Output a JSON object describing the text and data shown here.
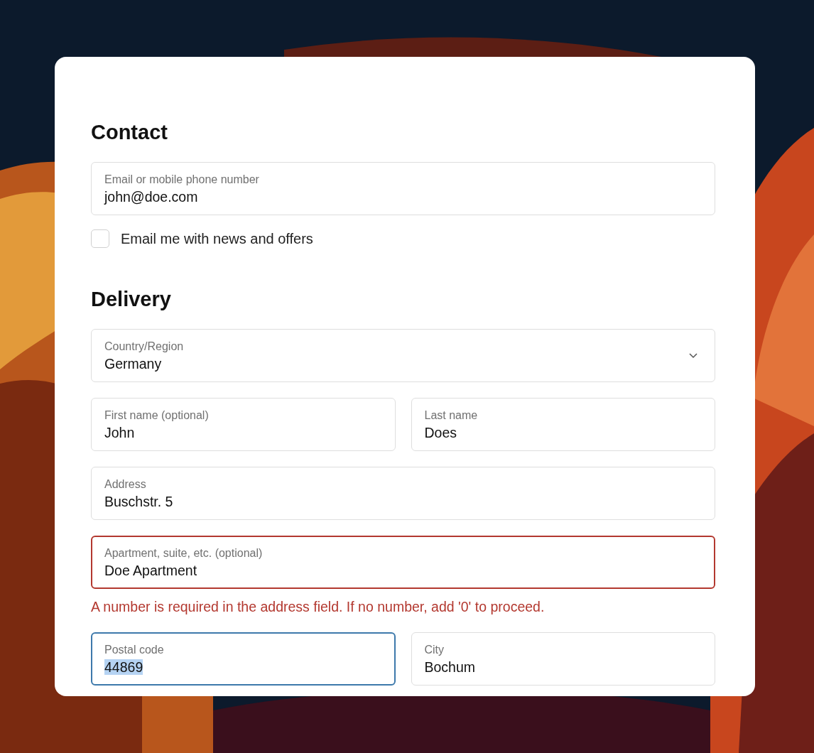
{
  "form": [
    {
      "kind": "heading",
      "text": "Contact"
    },
    {
      "kind": "fields",
      "fields": [
        {
          "kind": "text",
          "label": "Email or mobile phone number",
          "value": "john@doe.com",
          "invalid": false,
          "focused": false,
          "value_selected": false
        }
      ]
    },
    {
      "kind": "checkbox",
      "label": "Email me with news and offers",
      "checked": false
    },
    {
      "kind": "heading",
      "text": "Delivery"
    },
    {
      "kind": "fields",
      "fields": [
        {
          "kind": "select",
          "label": "Country/Region",
          "value": "Germany",
          "invalid": false,
          "focused": false,
          "value_selected": false
        }
      ]
    },
    {
      "kind": "fields",
      "fields": [
        {
          "kind": "text",
          "label": "First name (optional)",
          "value": "John",
          "invalid": false,
          "focused": false,
          "value_selected": false
        },
        {
          "kind": "text",
          "label": "Last name",
          "value": "Does",
          "invalid": false,
          "focused": false,
          "value_selected": false
        }
      ]
    },
    {
      "kind": "fields",
      "fields": [
        {
          "kind": "text",
          "label": "Address",
          "value": "Buschstr. 5",
          "invalid": false,
          "focused": false,
          "value_selected": false
        }
      ]
    },
    {
      "kind": "fields",
      "fields": [
        {
          "kind": "text",
          "label": "Apartment, suite, etc. (optional)",
          "value": "Doe Apartment",
          "invalid": true,
          "focused": false,
          "value_selected": false
        }
      ]
    },
    {
      "kind": "error",
      "text": "A number is required in the address field. If no number, add '0' to proceed."
    },
    {
      "kind": "fields",
      "fields": [
        {
          "kind": "text",
          "label": "Postal code",
          "value": "44869",
          "invalid": false,
          "focused": true,
          "value_selected": true
        },
        {
          "kind": "text",
          "label": "City",
          "value": "Bochum",
          "invalid": false,
          "focused": false,
          "value_selected": false
        }
      ]
    }
  ]
}
